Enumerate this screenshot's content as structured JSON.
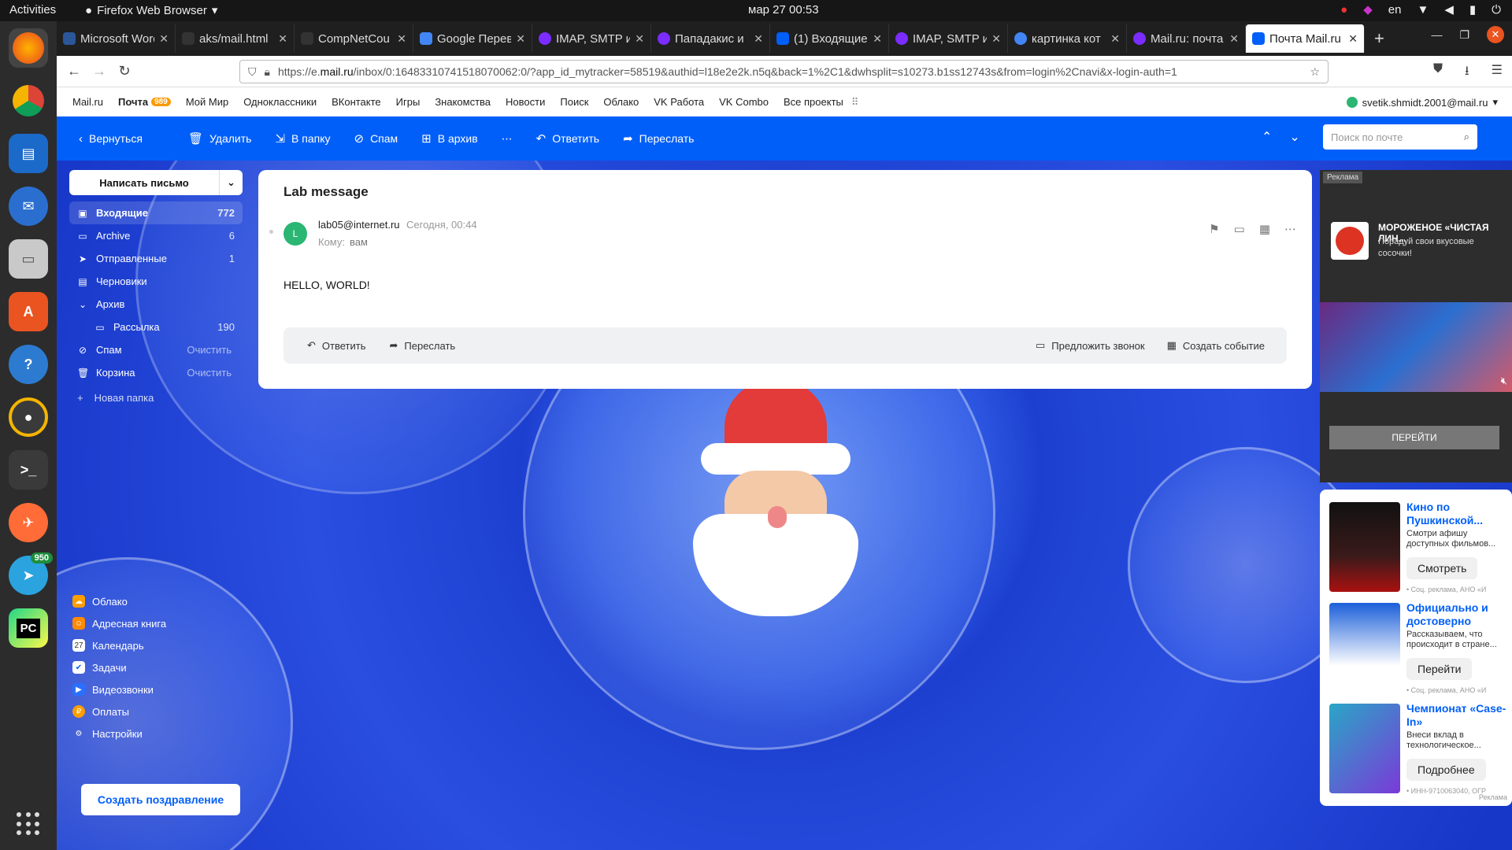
{
  "os": {
    "activities": "Activities",
    "app_name": "Firefox Web Browser",
    "clock": "мар 27  00:53",
    "lang": "en",
    "dock_badge": "950"
  },
  "tabs": [
    {
      "label": "Microsoft Word -",
      "color": "#2b579a"
    },
    {
      "label": "aks/mail.html",
      "color": "#333333"
    },
    {
      "label": "CompNetCou",
      "color": "#333333"
    },
    {
      "label": "Google Перев",
      "color": "#4285f4"
    },
    {
      "label": "IMAP, SMTP и",
      "color": "#7b2cff"
    },
    {
      "label": "Пападакис и",
      "color": "#7b2cff"
    },
    {
      "label": "(1) Входящие",
      "color": "#005ff9"
    },
    {
      "label": "IMAP, SMTP и",
      "color": "#7b2cff"
    },
    {
      "label": "картинка кот",
      "color": "#4285f4"
    },
    {
      "label": "Mail.ru: почта",
      "color": "#7b2cff"
    },
    {
      "label": "Почта Mail.ru",
      "color": "#005ff9"
    }
  ],
  "url": {
    "prefix": "https://e.",
    "domain": "mail.ru",
    "rest": "/inbox/0:16483310741518070062:0/?app_id_mytracker=58519&authid=l18e2e2k.n5q&back=1%2C1&dwhsplit=s10273.b1ss12743s&from=login%2Cnavi&x-login-auth=1"
  },
  "portal": {
    "links": [
      "Mail.ru",
      "Почта",
      "Мой Мир",
      "Одноклассники",
      "ВКонтакте",
      "Игры",
      "Знакомства",
      "Новости",
      "Поиск",
      "Облако",
      "VK Работа",
      "VK Combo",
      "Все проекты"
    ],
    "mail_badge": "989",
    "user": "svetik.shmidt.2001@mail.ru"
  },
  "toolbar": {
    "back": "Вернуться",
    "delete": "Удалить",
    "to_folder": "В папку",
    "spam": "Спам",
    "archive": "В архив",
    "reply": "Ответить",
    "forward": "Переслать",
    "search_placeholder": "Поиск по почте"
  },
  "sidebar": {
    "compose": "Написать письмо",
    "folders": [
      {
        "label": "Входящие",
        "count": "772"
      },
      {
        "label": "Archive",
        "count": "6"
      },
      {
        "label": "Отправленные",
        "count": "1"
      },
      {
        "label": "Черновики",
        "count": ""
      },
      {
        "label": "Архив",
        "count": ""
      },
      {
        "label": "Рассылка",
        "count": "190"
      },
      {
        "label": "Спам",
        "count": "Очистить"
      },
      {
        "label": "Корзина",
        "count": "Очистить"
      }
    ],
    "new_folder": "Новая папка",
    "tools": [
      "Облако",
      "Адресная книга",
      "Календарь",
      "Задачи",
      "Видеозвонки",
      "Оплаты",
      "Настройки"
    ],
    "greeting": "Создать поздравление"
  },
  "message": {
    "subject": "Lab message",
    "avatar_letter": "L",
    "from": "lab05@internet.ru",
    "date": "Сегодня, 00:44",
    "to_label": "Кому:",
    "to_value": "вам",
    "body": "HELLO, WORLD!",
    "reply": "Ответить",
    "forward": "Переслать",
    "propose_call": "Предложить звонок",
    "create_event": "Создать событие"
  },
  "ads": {
    "label": "Реклама",
    "top_title": "МОРОЖЕНОЕ «ЧИСТАЯ ЛИН...",
    "top_text": "Порадуй свои вкусовые сосочки!",
    "top_button": "ПЕРЕЙТИ",
    "cards": [
      {
        "title": "Кино по Пушкинской...",
        "text": "Смотри афишу доступных фильмов...",
        "button": "Смотреть",
        "small": "• Соц. реклама, АНО «И",
        "color": "#3a1a1a"
      },
      {
        "title": "Официально и достоверно",
        "text": "Рассказываем, что происходит в стране...",
        "button": "Перейти",
        "small": "• Соц. реклама, АНО «И",
        "color": "#1b5fd9"
      },
      {
        "title": "Чемпионат «Case-In»",
        "text": "Внеси вклад в технологическое...",
        "button": "Подробнее",
        "small": "• ИНН-9710063040, ОГР",
        "color": "#2aa6c6"
      }
    ],
    "footer": "Реклама"
  },
  "colors": {
    "accent": "#005ff9",
    "bg": "#1d3fd0",
    "green": "#2bb673"
  }
}
